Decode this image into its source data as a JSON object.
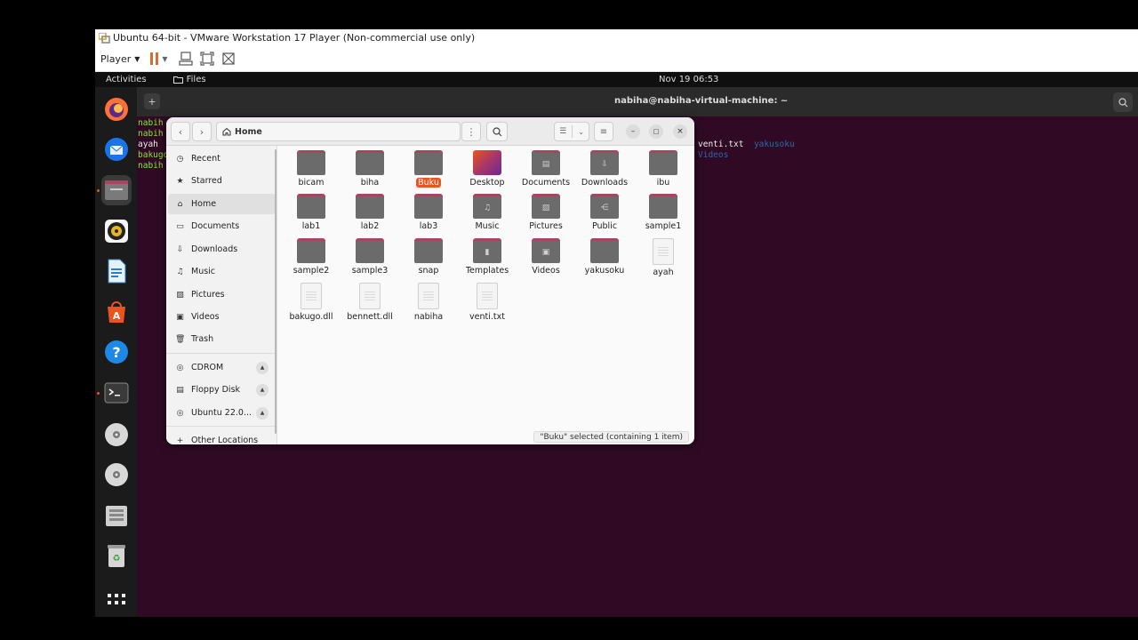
{
  "vmware": {
    "title": "Ubuntu 64-bit - VMware Workstation 17 Player (Non-commercial use only)",
    "player_label": "Player",
    "icons": [
      "pause-icon",
      "send-ctrl-alt-del-icon",
      "fullscreen-icon",
      "unity-icon"
    ]
  },
  "topbar": {
    "activities": "Activities",
    "app_menu": "Files",
    "clock": "Nov 19  06:53"
  },
  "dock": {
    "items": [
      "firefox",
      "thunderbird",
      "files",
      "rhythmbox",
      "libreoffice-writer",
      "app-center",
      "help",
      "terminal",
      "cdrom",
      "dvd",
      "floppy",
      "trash",
      "show-apps"
    ]
  },
  "terminal": {
    "title": "nabiha@nabiha-virtual-machine: ~",
    "left_lines": [
      "nabih",
      "nabih",
      "ayah",
      "bakugo",
      "nabih"
    ],
    "right_line_1_a": "venti.txt",
    "right_line_1_b": "yakusoku",
    "right_line_2": "Videos"
  },
  "files": {
    "path_label": "Home",
    "sidebar": {
      "items": [
        "Recent",
        "Starred",
        "Home",
        "Documents",
        "Downloads",
        "Music",
        "Pictures",
        "Videos",
        "Trash"
      ],
      "devices": [
        "CDROM",
        "Floppy Disk",
        "Ubuntu 22.0..."
      ],
      "other": "Other Locations"
    },
    "items": [
      {
        "name": "bicam",
        "kind": "folder"
      },
      {
        "name": "biha",
        "kind": "folder"
      },
      {
        "name": "Buku",
        "kind": "folder",
        "selected": true
      },
      {
        "name": "Desktop",
        "kind": "desktop"
      },
      {
        "name": "Documents",
        "kind": "folder",
        "emblem": "document"
      },
      {
        "name": "Downloads",
        "kind": "folder",
        "emblem": "download"
      },
      {
        "name": "ibu",
        "kind": "folder"
      },
      {
        "name": "lab1",
        "kind": "folder"
      },
      {
        "name": "lab2",
        "kind": "folder"
      },
      {
        "name": "lab3",
        "kind": "folder"
      },
      {
        "name": "Music",
        "kind": "folder",
        "emblem": "music"
      },
      {
        "name": "Pictures",
        "kind": "folder",
        "emblem": "picture"
      },
      {
        "name": "Public",
        "kind": "folder",
        "emblem": "share"
      },
      {
        "name": "sample1",
        "kind": "folder"
      },
      {
        "name": "sample2",
        "kind": "folder"
      },
      {
        "name": "sample3",
        "kind": "folder"
      },
      {
        "name": "snap",
        "kind": "folder"
      },
      {
        "name": "Templates",
        "kind": "folder",
        "emblem": "template"
      },
      {
        "name": "Videos",
        "kind": "folder",
        "emblem": "video"
      },
      {
        "name": "yakusoku",
        "kind": "folder"
      },
      {
        "name": "ayah",
        "kind": "file"
      },
      {
        "name": "bakugo.dll",
        "kind": "file"
      },
      {
        "name": "bennett.dll",
        "kind": "file"
      },
      {
        "name": "nabiha",
        "kind": "file"
      },
      {
        "name": "venti.txt",
        "kind": "file"
      }
    ],
    "status": "\"Buku\" selected  (containing 1 item)"
  },
  "colors": {
    "ubuntu_orange": "#e95420",
    "terminal_bg": "#300a24",
    "folder_body": "#6b6b6b",
    "folder_tab": "#a74662"
  }
}
